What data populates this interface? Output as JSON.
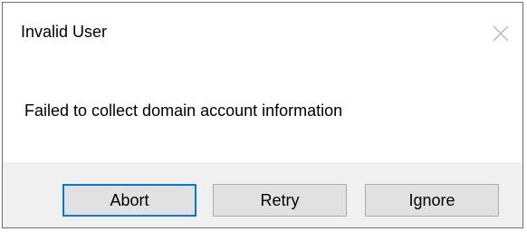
{
  "dialog": {
    "title": "Invalid User",
    "message": "Failed to collect domain account information",
    "close_icon": "close-icon",
    "buttons": {
      "abort_label": "Abort",
      "retry_label": "Retry",
      "ignore_label": "Ignore"
    },
    "default_button": "Abort",
    "accent_color": "#0078d7"
  }
}
